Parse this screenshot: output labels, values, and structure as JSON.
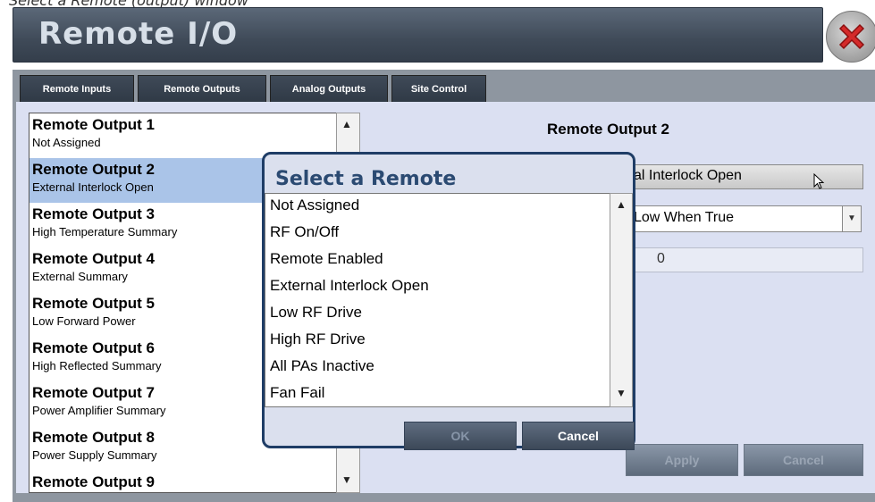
{
  "caption": "Select a Remote (output) window",
  "window": {
    "title": "Remote I/O"
  },
  "tabs": [
    {
      "label": "Remote Inputs"
    },
    {
      "label": "Remote Outputs"
    },
    {
      "label": "Analog Outputs"
    },
    {
      "label": "Site Control"
    }
  ],
  "outputs": [
    {
      "title": "Remote Output 1",
      "assignment": "Not Assigned"
    },
    {
      "title": "Remote Output 2",
      "assignment": "External Interlock Open"
    },
    {
      "title": "Remote Output 3",
      "assignment": "High Temperature Summary"
    },
    {
      "title": "Remote Output 4",
      "assignment": "External Summary"
    },
    {
      "title": "Remote Output 5",
      "assignment": "Low Forward Power"
    },
    {
      "title": "Remote Output 6",
      "assignment": "High Reflected Summary"
    },
    {
      "title": "Remote Output 7",
      "assignment": "Power Amplifier Summary"
    },
    {
      "title": "Remote Output 8",
      "assignment": "Power Supply Summary"
    },
    {
      "title": "Remote Output 9",
      "assignment": ""
    }
  ],
  "detail": {
    "title": "Remote Output 2",
    "assignment_visible": "al Interlock Open",
    "mode_visible": "Low When True",
    "value": "0",
    "apply_label": "Apply",
    "cancel_label": "Cancel"
  },
  "dialog": {
    "title": "Select a Remote",
    "options": [
      "Not Assigned",
      "RF On/Off",
      "Remote Enabled",
      "External Interlock Open",
      "Low RF Drive",
      "High RF Drive",
      "All PAs Inactive",
      "Fan Fail"
    ],
    "ok_label": "OK",
    "cancel_label": "Cancel"
  },
  "icons": {
    "close": "close-icon",
    "scroll_up": "▲",
    "scroll_down": "▼",
    "dropdown": "▼"
  },
  "colors": {
    "title_bar": "#4a5566",
    "tab_bg": "#36414f",
    "selected_row": "#aac4e8",
    "content_bg": "#dbe0f2",
    "dialog_border": "#1f3d66",
    "close_red": "#d42a2a"
  }
}
